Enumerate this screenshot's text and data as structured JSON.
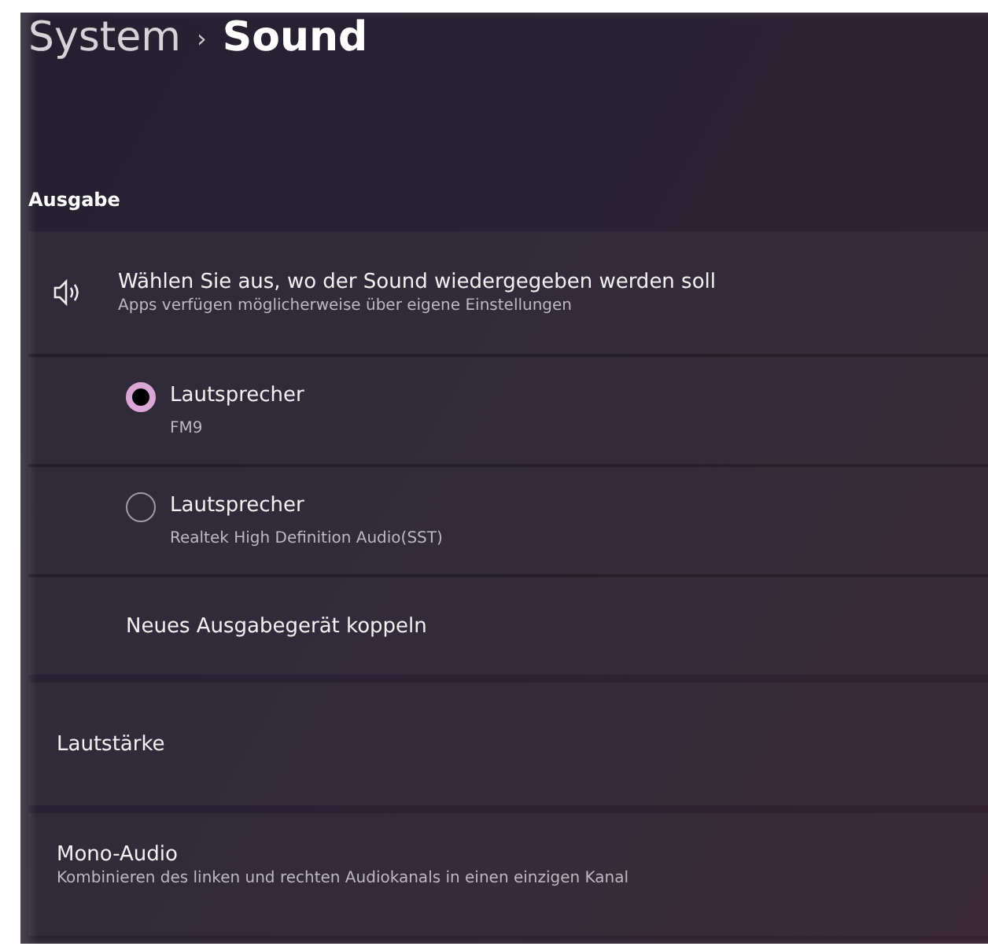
{
  "breadcrumb": {
    "parent": "System",
    "separator": "›",
    "current": "Sound"
  },
  "section_title": "Ausgabe",
  "output_card": {
    "title": "Wählen Sie aus, wo der Sound wiedergegeben werden soll",
    "subtitle": "Apps verfügen möglicherweise über eigene Einstellungen",
    "devices": [
      {
        "name": "Lautsprecher",
        "detail": "FM9",
        "selected": true
      },
      {
        "name": "Lautsprecher",
        "detail": "Realtek High Definition Audio(SST)",
        "selected": false
      }
    ],
    "pair_link": "Neues Ausgabegerät koppeln"
  },
  "settings": [
    {
      "title": "Lautstärke"
    },
    {
      "title": "Mono-Audio",
      "subtitle": "Kombinieren des linken und rechten Audiokanals in einen einzigen Kanal"
    }
  ]
}
